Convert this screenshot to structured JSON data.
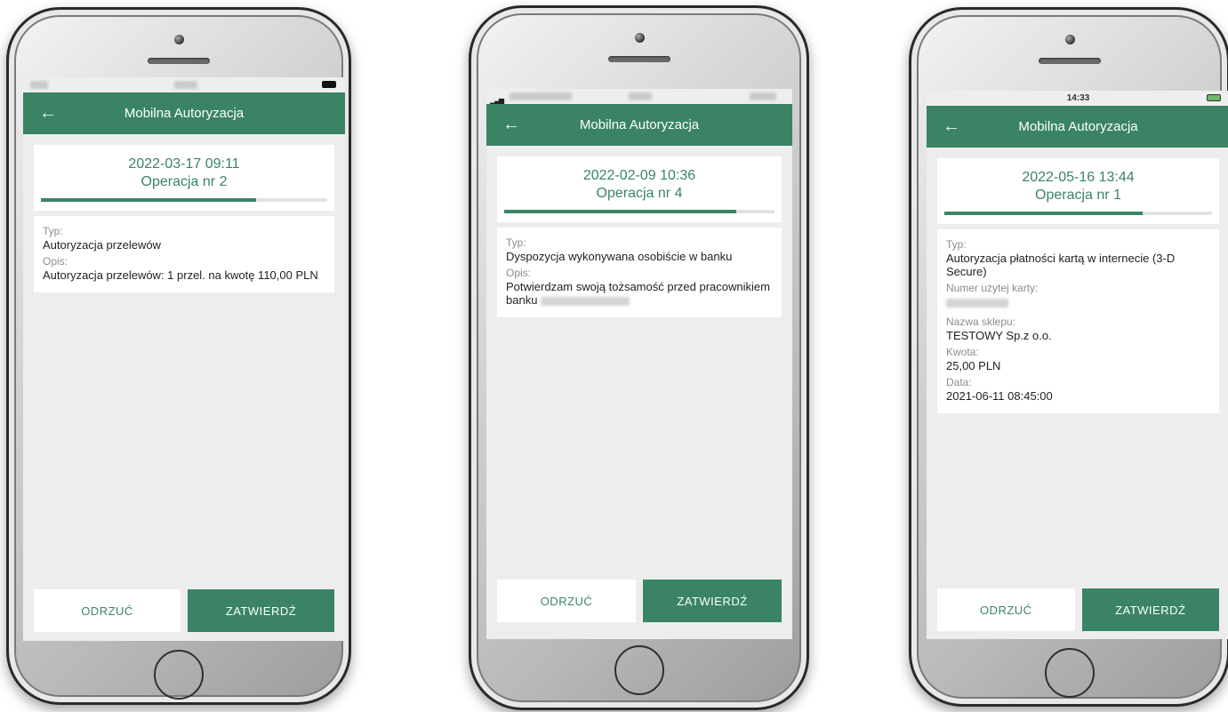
{
  "phones": [
    {
      "status_time": "",
      "title": "Mobilna Autoryzacja",
      "datetime": "2022-03-17 09:11",
      "operation": "Operacja nr 2",
      "progress": 0.75,
      "fields": [
        {
          "label": "Typ:",
          "value": "Autoryzacja przelewów"
        },
        {
          "label": "Opis:",
          "value": "Autoryzacja przelewów: 1 przel. na kwotę 110,00 PLN"
        }
      ],
      "reject_label": "ODRZUĆ",
      "confirm_label": "ZATWIERDŹ"
    },
    {
      "status_time": "",
      "title": "Mobilna Autoryzacja",
      "datetime": "2022-02-09 10:36",
      "operation": "Operacja nr 4",
      "progress": 0.86,
      "fields": [
        {
          "label": "Typ:",
          "value": "Dyspozycja wykonywana osobiście w banku"
        },
        {
          "label": "Opis:",
          "value": "Potwierdzam swoją tożsamość przed pracownikiem banku"
        }
      ],
      "reject_label": "ODRZUĆ",
      "confirm_label": "ZATWIERDŹ"
    },
    {
      "status_time": "14:33",
      "title": "Mobilna Autoryzacja",
      "datetime": "2022-05-16 13:44",
      "operation": "Operacja nr 1",
      "progress": 0.74,
      "fields": [
        {
          "label": "Typ:",
          "value": "Autoryzacja płatności kartą w internecie (3-D Secure)"
        },
        {
          "label": "Numer użytej karty:",
          "value": ""
        },
        {
          "label": "Nazwa sklepu:",
          "value": "TESTOWY Sp.z o.o."
        },
        {
          "label": "Kwota:",
          "value": "25,00 PLN"
        },
        {
          "label": "Data:",
          "value": "2021-06-11 08:45:00"
        }
      ],
      "reject_label": "ODRZUĆ",
      "confirm_label": "ZATWIERDŹ"
    }
  ],
  "colors": {
    "brand": "#3a8465",
    "label": "#8c8c8c",
    "screen_bg": "#ededed"
  },
  "icons": {
    "back": "arrow-left-icon",
    "battery": "battery-icon",
    "home": "home-button"
  }
}
